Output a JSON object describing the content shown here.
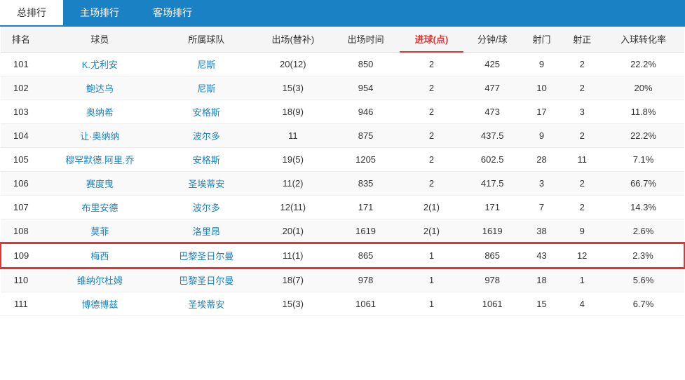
{
  "tabs": [
    {
      "label": "总排行",
      "active": true
    },
    {
      "label": "主场排行",
      "active": false
    },
    {
      "label": "客场排行",
      "active": false
    }
  ],
  "columns": [
    {
      "key": "rank",
      "label": "排名",
      "highlight": false
    },
    {
      "key": "player",
      "label": "球员",
      "highlight": false
    },
    {
      "key": "team",
      "label": "所属球队",
      "highlight": false
    },
    {
      "key": "appearances",
      "label": "出场(替补)",
      "highlight": false
    },
    {
      "key": "minutes_played",
      "label": "出场时间",
      "highlight": false
    },
    {
      "key": "goals",
      "label": "进球(点)",
      "highlight": true
    },
    {
      "key": "min_per_goal",
      "label": "分钟/球",
      "highlight": false
    },
    {
      "key": "shots",
      "label": "射门",
      "highlight": false
    },
    {
      "key": "on_target",
      "label": "射正",
      "highlight": false
    },
    {
      "key": "conversion",
      "label": "入球转化率",
      "highlight": false
    }
  ],
  "rows": [
    {
      "rank": "101",
      "player": "K.尤利安",
      "team": "尼斯",
      "appearances": "20(12)",
      "minutes_played": "850",
      "goals": "2",
      "min_per_goal": "425",
      "shots": "9",
      "on_target": "2",
      "conversion": "22.2%",
      "highlighted": false
    },
    {
      "rank": "102",
      "player": "鲍达乌",
      "team": "尼斯",
      "appearances": "15(3)",
      "minutes_played": "954",
      "goals": "2",
      "min_per_goal": "477",
      "shots": "10",
      "on_target": "2",
      "conversion": "20%",
      "highlighted": false
    },
    {
      "rank": "103",
      "player": "奥纳希",
      "team": "安格斯",
      "appearances": "18(9)",
      "minutes_played": "946",
      "goals": "2",
      "min_per_goal": "473",
      "shots": "17",
      "on_target": "3",
      "conversion": "11.8%",
      "highlighted": false
    },
    {
      "rank": "104",
      "player": "让·奥纳纳",
      "team": "波尔多",
      "appearances": "11",
      "minutes_played": "875",
      "goals": "2",
      "min_per_goal": "437.5",
      "shots": "9",
      "on_target": "2",
      "conversion": "22.2%",
      "highlighted": false
    },
    {
      "rank": "105",
      "player": "穆罕默德.阿里.乔",
      "team": "安格斯",
      "appearances": "19(5)",
      "minutes_played": "1205",
      "goals": "2",
      "min_per_goal": "602.5",
      "shots": "28",
      "on_target": "11",
      "conversion": "7.1%",
      "highlighted": false
    },
    {
      "rank": "106",
      "player": "赛度曳",
      "team": "圣埃蒂安",
      "appearances": "11(2)",
      "minutes_played": "835",
      "goals": "2",
      "min_per_goal": "417.5",
      "shots": "3",
      "on_target": "2",
      "conversion": "66.7%",
      "highlighted": false
    },
    {
      "rank": "107",
      "player": "布里安德",
      "team": "波尔多",
      "appearances": "12(11)",
      "minutes_played": "171",
      "goals": "2(1)",
      "min_per_goal": "171",
      "shots": "7",
      "on_target": "2",
      "conversion": "14.3%",
      "highlighted": false
    },
    {
      "rank": "108",
      "player": "莫菲",
      "team": "洛里昂",
      "appearances": "20(1)",
      "minutes_played": "1619",
      "goals": "2(1)",
      "min_per_goal": "1619",
      "shots": "38",
      "on_target": "9",
      "conversion": "2.6%",
      "highlighted": false
    },
    {
      "rank": "109",
      "player": "梅西",
      "team": "巴黎圣日尔曼",
      "appearances": "11(1)",
      "minutes_played": "865",
      "goals": "1",
      "min_per_goal": "865",
      "shots": "43",
      "on_target": "12",
      "conversion": "2.3%",
      "highlighted": true
    },
    {
      "rank": "110",
      "player": "维纳尔杜姆",
      "team": "巴黎圣日尔曼",
      "appearances": "18(7)",
      "minutes_played": "978",
      "goals": "1",
      "min_per_goal": "978",
      "shots": "18",
      "on_target": "1",
      "conversion": "5.6%",
      "highlighted": false
    },
    {
      "rank": "111",
      "player": "博德博兹",
      "team": "圣埃蒂安",
      "appearances": "15(3)",
      "minutes_played": "1061",
      "goals": "1",
      "min_per_goal": "1061",
      "shots": "15",
      "on_target": "4",
      "conversion": "6.7%",
      "highlighted": false
    }
  ]
}
